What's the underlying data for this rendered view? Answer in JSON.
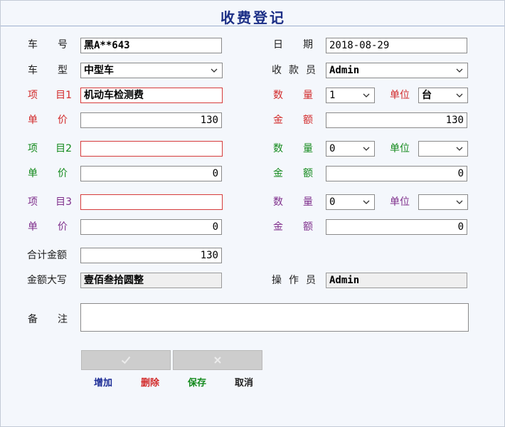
{
  "form": {
    "title": "收费登记",
    "plate_label": [
      "车",
      "号"
    ],
    "plate_value": "黑A**643",
    "date_label": [
      "日",
      "期"
    ],
    "date_value": "2018-08-29",
    "vehicle_type_label": [
      "车",
      "型"
    ],
    "vehicle_type_value": "中型车",
    "cashier_label": [
      "收",
      "款",
      "员"
    ],
    "cashier_value": "Admin",
    "items": [
      {
        "label": [
          "项",
          "目1"
        ],
        "value": "机动车检测费",
        "qty_label": [
          "数",
          "量"
        ],
        "qty_value": "1",
        "unit_label": "单位",
        "unit_value": "台",
        "price_label": [
          "单",
          "价"
        ],
        "price_value": "130",
        "amount_label": [
          "金",
          "额"
        ],
        "amount_value": "130",
        "color": "#d22a2a"
      },
      {
        "label": [
          "项",
          "目2"
        ],
        "value": "",
        "qty_label": [
          "数",
          "量"
        ],
        "qty_value": "0",
        "unit_label": "单位",
        "unit_value": "",
        "price_label": [
          "单",
          "价"
        ],
        "price_value": "0",
        "amount_label": [
          "金",
          "额"
        ],
        "amount_value": "0",
        "color": "#138a1c"
      },
      {
        "label": [
          "项",
          "目3"
        ],
        "value": "",
        "qty_label": [
          "数",
          "量"
        ],
        "qty_value": "0",
        "unit_label": "单位",
        "unit_value": "",
        "price_label": [
          "单",
          "价"
        ],
        "price_value": "0",
        "amount_label": [
          "金",
          "额"
        ],
        "amount_value": "0",
        "color": "#7f2f8c"
      }
    ],
    "total_label": "合计金额",
    "total_value": "130",
    "total_upper_label": "金额大写",
    "total_upper_value": "壹佰叁拾圆整",
    "operator_label": [
      "操",
      "作",
      "员"
    ],
    "operator_value": "Admin",
    "remark_label": [
      "备",
      "注"
    ],
    "remark_value": ""
  },
  "toolbar": {
    "confirm_icon": "check-icon",
    "cancel_icon": "x-icon",
    "add_label": "增加",
    "delete_label": "删除",
    "save_label": "保存",
    "cancel_label": "取消"
  }
}
